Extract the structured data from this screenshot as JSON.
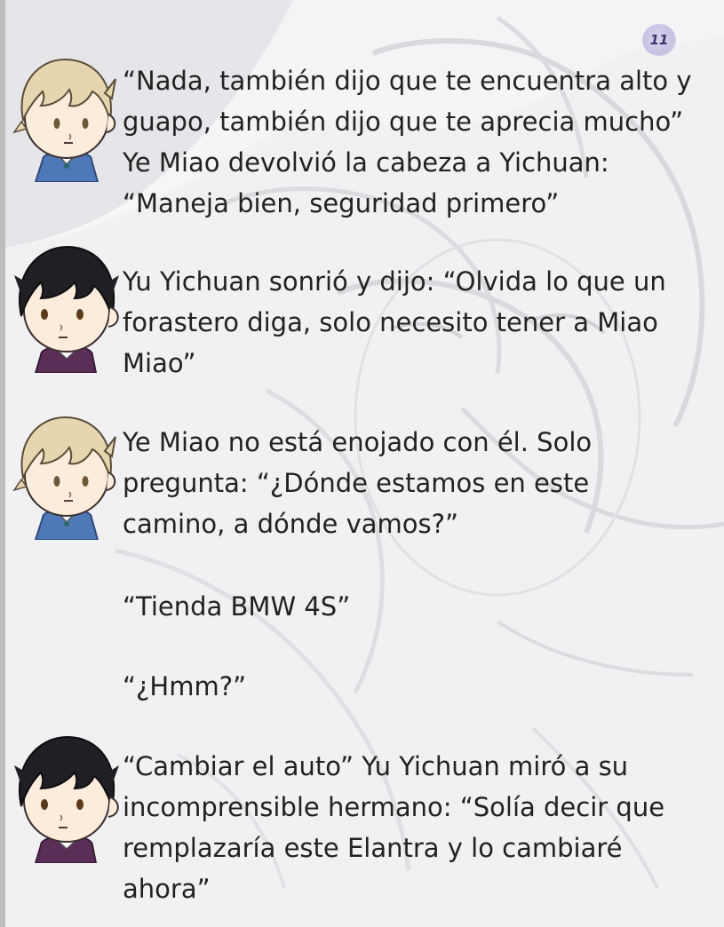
{
  "page": {
    "number": "11"
  },
  "colors": {
    "blond_hair": "#e5d6b0",
    "dark_hair": "#1f1f24",
    "skin": "#fcecdc",
    "blue_shirt": "#4f78b8",
    "purple_shirt": "#5a2e57",
    "text": "#222222",
    "page_number_badge": "#c8c2e3"
  },
  "dialogue": [
    {
      "speaker_avatar": "blond-boy-avatar",
      "lines": [
        "“Nada, también dijo que te encuentra alto y",
        "guapo, también dijo que te aprecia mucho”",
        "Ye Miao devolvió la cabeza a Yichuan:",
        "“Maneja bien, seguridad primero”"
      ]
    },
    {
      "speaker_avatar": "dark-hair-boy-avatar",
      "lines": [
        "Yu Yichuan sonrió y dijo: “Olvida lo que un",
        "forastero diga, solo necesito tener a Miao",
        "Miao”"
      ]
    },
    {
      "speaker_avatar": "blond-boy-avatar",
      "lines": [
        "Ye Miao no está enojado con él. Solo",
        "pregunta: “¿Dónde estamos en este",
        "camino, a dónde vamos?”"
      ]
    },
    {
      "speaker_avatar": "none",
      "lines": [
        "“Tienda BMW 4S”"
      ]
    },
    {
      "speaker_avatar": "none",
      "lines": [
        "“¿Hmm?”"
      ]
    },
    {
      "speaker_avatar": "dark-hair-boy-avatar",
      "lines": [
        "“Cambiar el auto” Yu Yichuan miró a su",
        "incomprensible hermano: “Solía decir que",
        "remplazaría este Elantra y lo cambiaré",
        "ahora”"
      ]
    }
  ]
}
